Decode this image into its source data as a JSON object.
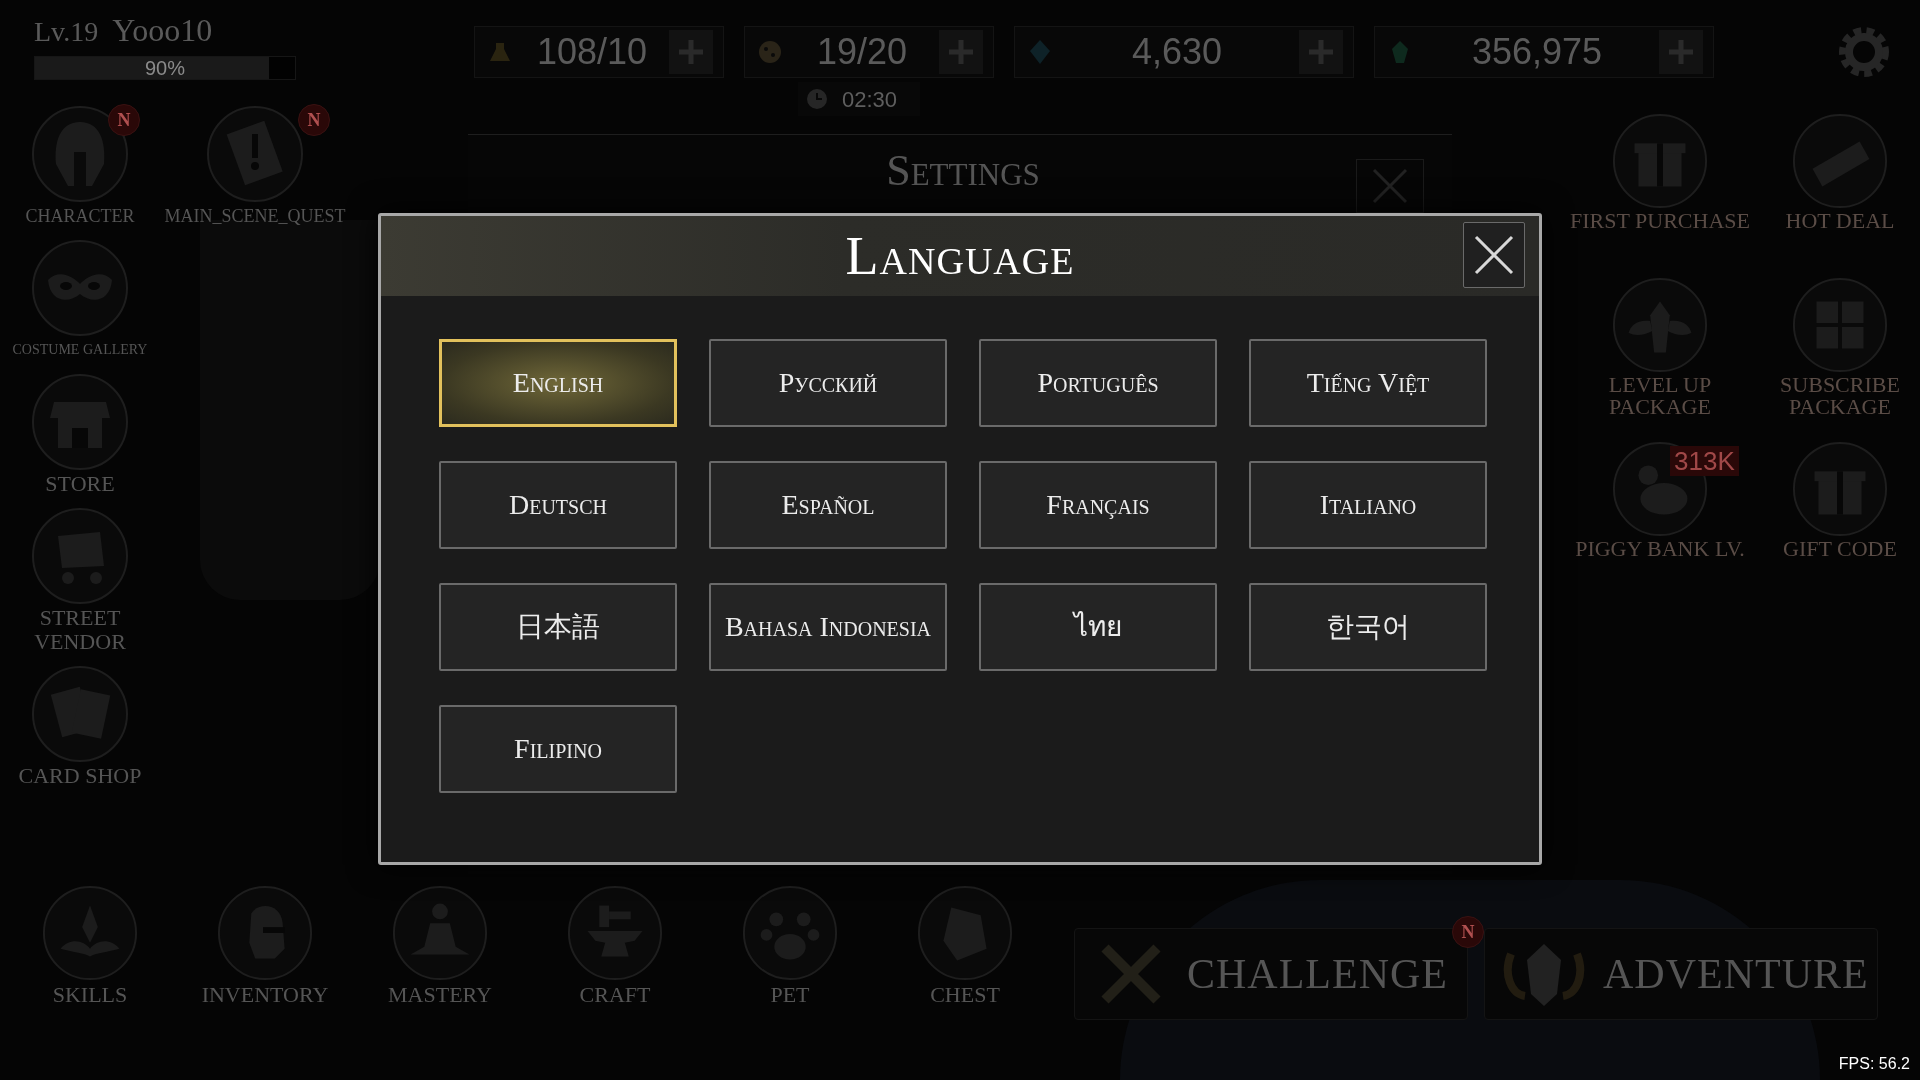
{
  "hud": {
    "level": "Lv.19",
    "player_name": "Yooo10",
    "xp": {
      "label": "90%",
      "level": 0.9
    },
    "resources": [
      {
        "value": "108/10"
      },
      {
        "value": "19/20"
      },
      {
        "value": "4,630"
      },
      {
        "value": "356,975"
      }
    ],
    "timer": "02:30"
  },
  "left_menu": [
    {
      "label": "CHARACTER",
      "badge": "N"
    },
    {
      "label": "MAIN_SCENE_QUEST",
      "badge": "N"
    },
    {
      "label": "COSTUME GALLERY"
    },
    {
      "label": "STORE"
    },
    {
      "label": "STREET VENDOR"
    },
    {
      "label": "CARD SHOP"
    }
  ],
  "right_menu": [
    {
      "label": "FIRST PURCHASE"
    },
    {
      "label": "HOT DEAL"
    },
    {
      "label": "LEVEL UP PACKAGE"
    },
    {
      "label": "SUBSCRIBE PACKAGE"
    },
    {
      "label": "PIGGY BANK LV.",
      "badge": "313K"
    },
    {
      "label": "GIFT CODE"
    }
  ],
  "bottom_menu": [
    {
      "label": "SKILLS"
    },
    {
      "label": "INVENTORY"
    },
    {
      "label": "MASTERY"
    },
    {
      "label": "CRAFT"
    },
    {
      "label": "PET"
    },
    {
      "label": "CHEST"
    }
  ],
  "mode_buttons": [
    {
      "label": "CHALLENGE",
      "badge": "N"
    },
    {
      "label": "ADVENTURE"
    }
  ],
  "settings_dialog": {
    "title": "Settings"
  },
  "language_dialog": {
    "title": "Language",
    "languages": [
      {
        "label": "English",
        "selected": true
      },
      {
        "label": "Русский",
        "selected": false
      },
      {
        "label": "Português",
        "selected": false
      },
      {
        "label": "Tiếng Việt",
        "selected": false
      },
      {
        "label": "Deutsch",
        "selected": false
      },
      {
        "label": "Español",
        "selected": false
      },
      {
        "label": "Français",
        "selected": false
      },
      {
        "label": "Italiano",
        "selected": false
      },
      {
        "label": "日本語",
        "selected": false
      },
      {
        "label": "Bahasa Indonesia",
        "selected": false
      },
      {
        "label": "ไทย",
        "selected": false
      },
      {
        "label": "한국어",
        "selected": false
      },
      {
        "label": "Filipino",
        "selected": false
      }
    ]
  },
  "fps": "FPS: 56.2"
}
